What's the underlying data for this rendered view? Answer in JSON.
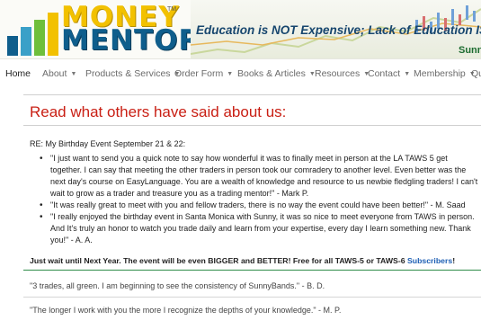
{
  "logo": {
    "line1": "MONEY",
    "line2": "MENTOR",
    "tm": "TM"
  },
  "banner": {
    "tagline": "Education is NOT Expensive; Lack of Education IS!",
    "subtext": "Sunn"
  },
  "nav": {
    "items": [
      {
        "label": "Home",
        "active": true,
        "caret": false
      },
      {
        "label": "About",
        "active": false,
        "caret": true
      },
      {
        "label": "Products & Services",
        "active": false,
        "caret": true
      },
      {
        "label": "Order Form",
        "active": false,
        "caret": true
      },
      {
        "label": "Books & Articles",
        "active": false,
        "caret": true
      },
      {
        "label": "Resources",
        "active": false,
        "caret": true
      },
      {
        "label": "Contact",
        "active": false,
        "caret": true
      },
      {
        "label": "Membership",
        "active": false,
        "caret": true
      },
      {
        "label": "Qu",
        "active": false,
        "caret": false
      }
    ]
  },
  "main": {
    "title": "Read what others have said about us:",
    "event_heading": "RE: My Birthday Event September 21 & 22:",
    "testimonials": [
      "\"I just want to send you a quick note to say how wonderful it was to finally meet in person at the LA TAWS 5 get together. I can say that meeting the other traders in person took our comradery to another level. Even better was the next day's course on EasyLanguage. You are a wealth of knowledge and resource to us newbie fledgling traders! I can't wait to grow as a trader and treasure you as a trading mentor!\" - Mark P.",
      "\"It was really great to meet with you and fellow traders, there is no way the event could have been better!\" - M. Saad",
      "\"I really enjoyed the birthday event in Santa Monica with Sunny, it was so nice to meet everyone from TAWS in person. And It's truly an honor to watch you trade daily and learn from your expertise, every day I learn something new. Thank you!\" - A. A."
    ],
    "promo_text": "Just wait until Next Year. The event will be even BIGGER and BETTER! Free for all TAWS-5 or TAWS-6 ",
    "promo_link": "Subscribers",
    "promo_end": "!",
    "quotes": [
      "\"3 trades, all green. I am beginning to see the consistency of SunnyBands.\" - B. D.",
      "\"The longer I work with you the more I recognize the depths of your knowledge.\" - M. P."
    ]
  },
  "colors": {
    "title_red": "#c91f14",
    "logo_yellow": "#f2c100",
    "logo_blue": "#0f5e8c",
    "link_blue": "#1d5fb4",
    "rule_green": "#2f8d4a"
  }
}
